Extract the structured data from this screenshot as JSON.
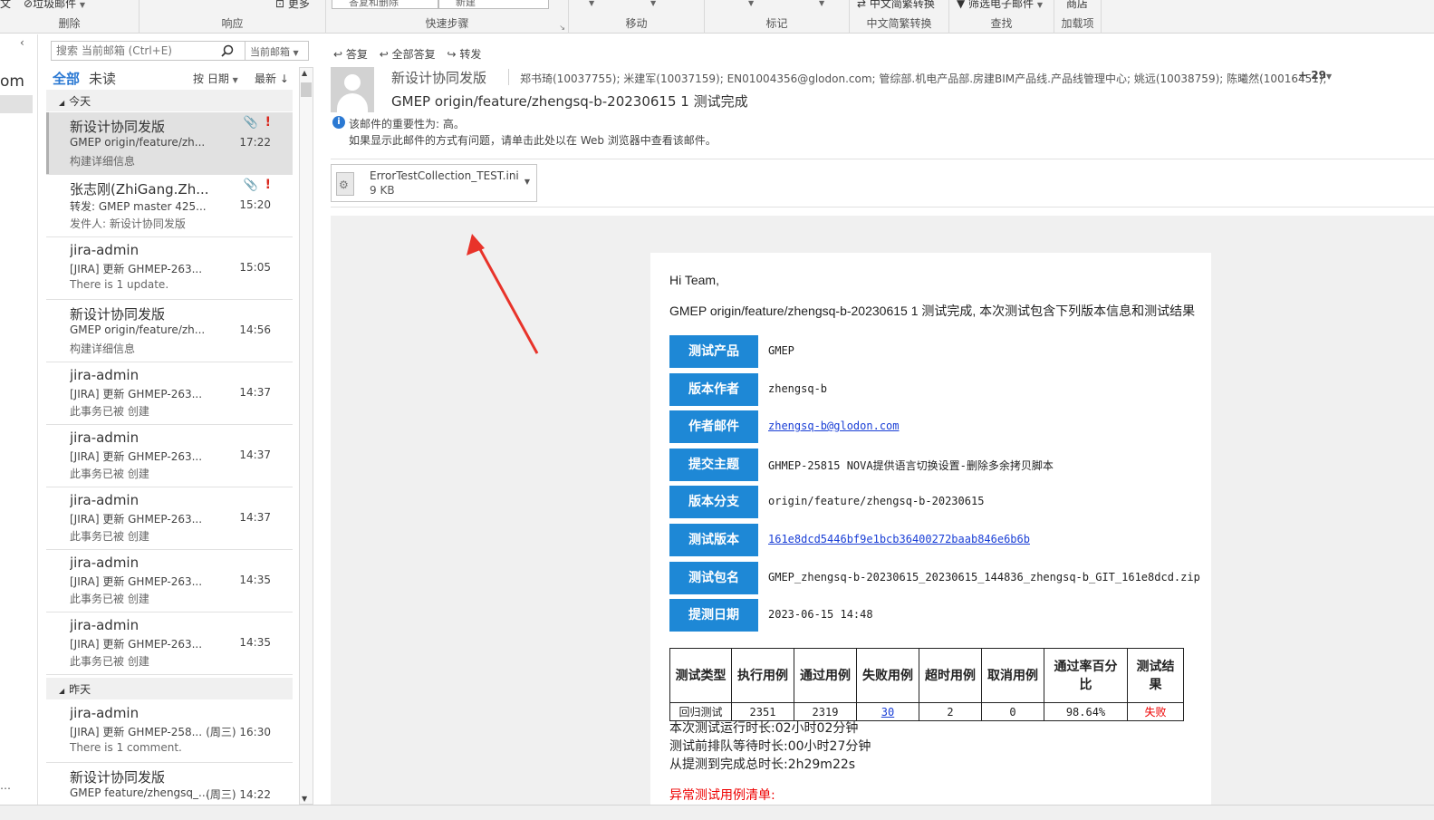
{
  "ribbon": {
    "junk_label": "垃圾邮件",
    "groups": [
      {
        "label": "删除"
      },
      {
        "label": "响应"
      },
      {
        "label": "快速步骤",
        "box1": "答复和删除",
        "box2": "新建"
      },
      {
        "label": "移动"
      },
      {
        "label": "标记"
      },
      {
        "label": "中文简繁转换",
        "top": "中文简繁转换"
      },
      {
        "label": "查找",
        "top": "筛选电子邮件"
      },
      {
        "label": "加载项",
        "top": "商店"
      }
    ]
  },
  "nav": {
    "partial_text": "om"
  },
  "message_list": {
    "search_placeholder": "搜索 当前邮箱 (Ctrl+E)",
    "scope": "当前邮箱",
    "tab_all": "全部",
    "tab_unread": "未读",
    "sort_by": "按 日期",
    "sort_order": "最新 ↓",
    "groups": {
      "today": "今天",
      "yesterday": "昨天"
    },
    "items": [
      {
        "sender": "新设计协同发版",
        "subject": "GMEP origin/feature/zh...",
        "time": "17:22",
        "preview": "构建详细信息",
        "attachment": true,
        "important": true
      },
      {
        "sender": "张志刚(ZhiGang.Zh...",
        "subject": "转发: GMEP master 425...",
        "time": "15:20",
        "preview": "发件人: 新设计协同发版",
        "attachment": true,
        "important": true
      },
      {
        "sender": "jira-admin",
        "subject": "[JIRA] 更新 GHMEP-263...",
        "time": "15:05",
        "preview": "There is 1 update."
      },
      {
        "sender": "新设计协同发版",
        "subject": "GMEP origin/feature/zh...",
        "time": "14:56",
        "preview": "构建详细信息"
      },
      {
        "sender": "jira-admin",
        "subject": "[JIRA] 更新 GHMEP-263...",
        "time": "14:37",
        "preview": "此事务已被 创建"
      },
      {
        "sender": "jira-admin",
        "subject": "[JIRA] 更新 GHMEP-263...",
        "time": "14:37",
        "preview": "此事务已被 创建"
      },
      {
        "sender": "jira-admin",
        "subject": "[JIRA] 更新 GHMEP-263...",
        "time": "14:37",
        "preview": "此事务已被 创建"
      },
      {
        "sender": "jira-admin",
        "subject": "[JIRA] 更新 GHMEP-263...",
        "time": "14:35",
        "preview": "此事务已被 创建"
      },
      {
        "sender": "jira-admin",
        "subject": "[JIRA] 更新 GHMEP-263...",
        "time": "14:35",
        "preview": "此事务已被 创建"
      },
      {
        "sender": "jira-admin",
        "subject": "[JIRA] 更新 GHMEP-258...",
        "time": "(周三) 16:30",
        "preview": "There is 1 comment."
      },
      {
        "sender": "新设计协同发版",
        "subject": "GMEP feature/zhengsq_...",
        "time": "(周三) 14:22",
        "preview": "构建详细信息"
      }
    ]
  },
  "reading": {
    "actions": {
      "reply": "答复",
      "reply_all": "全部答复",
      "forward": "转发"
    },
    "sender": "新设计协同发版",
    "recipients": "郑书琦(10037755); 米建军(10037159); EN01004356@glodon.com; 管综部.机电产品部.房建BIM产品线.产品线管理中心; 姚远(10038759); 陈曦然(10016451);",
    "more_count": "+ 29",
    "subject": "GMEP origin/feature/zhengsq-b-20230615 1 测试完成",
    "importance": "该邮件的重要性为: 高。",
    "web_notice": "如果显示此邮件的方式有问题，请单击此处以在 Web 浏览器中查看该邮件。",
    "attachment": {
      "name": "ErrorTestCollection_TEST.ini",
      "size": "9 KB"
    }
  },
  "email": {
    "greeting": "Hi Team,",
    "intro": "GMEP origin/feature/zhengsq-b-20230615 1 测试完成, 本次测试包含下列版本信息和测试结果",
    "rows": [
      {
        "label": "测试产品",
        "value": "GMEP"
      },
      {
        "label": "版本作者",
        "value": "zhengsq-b"
      },
      {
        "label": "作者邮件",
        "value": "zhengsq-b@glodon.com"
      },
      {
        "label": "提交主题",
        "value": "GHMEP-25815 NOVA提供语言切换设置-删除多余拷贝脚本"
      },
      {
        "label": "版本分支",
        "value": "origin/feature/zhengsq-b-20230615"
      },
      {
        "label": "测试版本",
        "value": "161e8dcd5446bf9e1bcb36400272baab846e6b6b"
      },
      {
        "label": "测试包名",
        "value": "GMEP_zhengsq-b-20230615_20230615_144836_zhengsq-b_GIT_161e8dcd.zip"
      },
      {
        "label": "提测日期",
        "value": "2023-06-15 14:48"
      }
    ],
    "table": {
      "headers": [
        "测试类型",
        "执行用例",
        "通过用例",
        "失败用例",
        "超时用例",
        "取消用例",
        "通过率百分比",
        "测试结果"
      ],
      "row": [
        "回归测试",
        "2351",
        "2319",
        "30",
        "2",
        "0",
        "98.64%",
        "失败"
      ]
    },
    "run_time": "本次测试运行时长:02小时02分钟",
    "queue_time": "测试前排队等待时长:00小时27分钟",
    "total_time": "从提测到完成总时长:2h29m22s",
    "abnormal": "异常测试用例清单:"
  }
}
